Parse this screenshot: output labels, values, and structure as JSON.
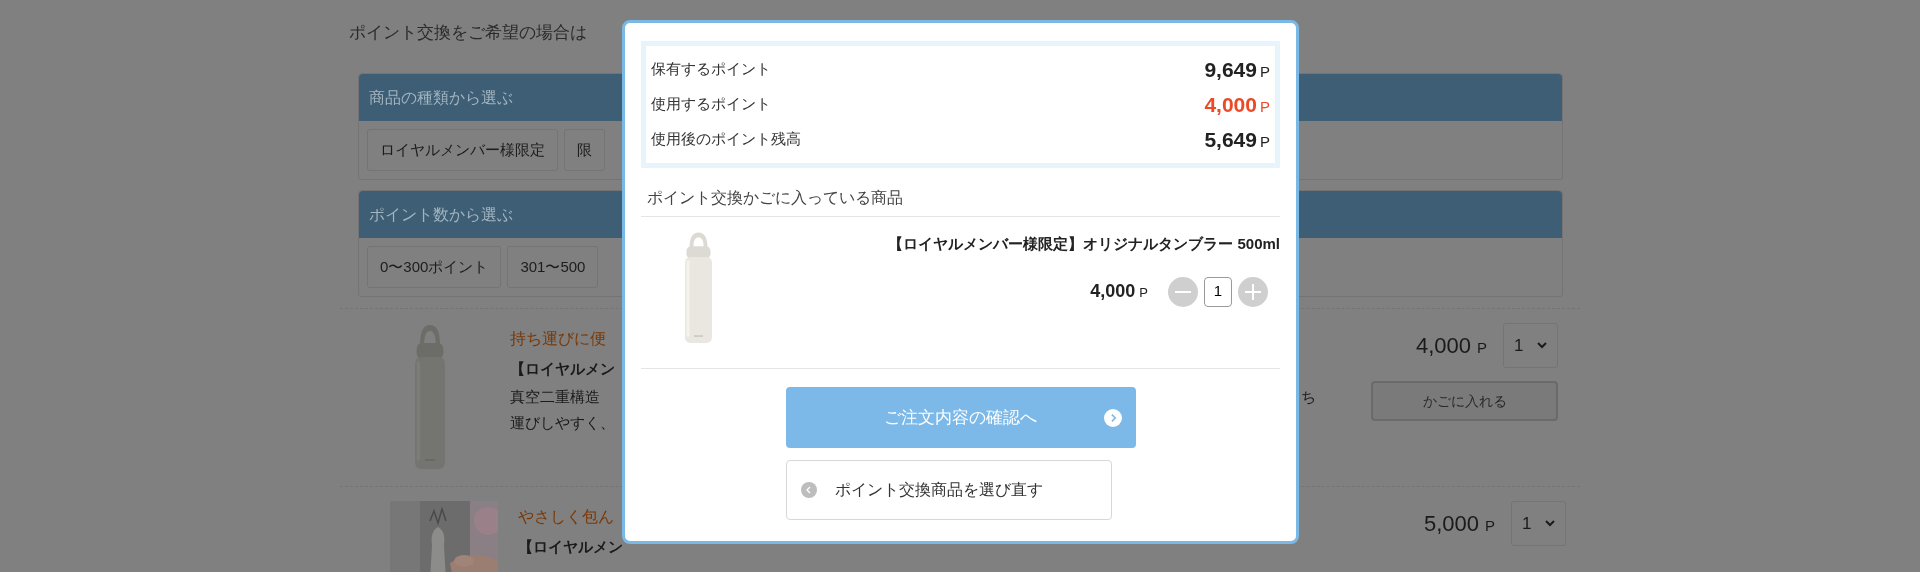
{
  "page": {
    "intro": "ポイント交換をご希望の場合は",
    "filters": [
      {
        "title": "商品の種類から選ぶ",
        "options": [
          "ロイヤルメンバー様限定",
          "限"
        ]
      },
      {
        "title": "ポイント数から選ぶ",
        "options": [
          "0〜300ポイント",
          "301〜500"
        ]
      }
    ],
    "products": [
      {
        "kind": "bottle",
        "catch": "持ち運びに便",
        "name": "【ロイヤルメン",
        "description": [
          "真空二重構造",
          "運びしやすく、"
        ],
        "description_end": "ち",
        "price": "4,000",
        "unit": "P",
        "quantity": "1",
        "button": "かごに入れる"
      },
      {
        "catch": "やさしく包ん",
        "name": "【ロイヤルメン",
        "price": "5,000",
        "unit": "P",
        "quantity": "1"
      }
    ]
  },
  "modal": {
    "points": [
      {
        "label": "保有するポイント",
        "value": "9,649",
        "unit": "P",
        "highlight": false
      },
      {
        "label": "使用するポイント",
        "value": "4,000",
        "unit": "P",
        "highlight": true
      },
      {
        "label": "使用後のポイント残高",
        "value": "5,649",
        "unit": "P",
        "highlight": false
      }
    ],
    "cart_title": "ポイント交換かごに入っている商品",
    "items": [
      {
        "name": "【ロイヤルメンバー様限定】オリジナルタンブラー 500ml",
        "price": "4,000",
        "unit": "P",
        "quantity": "1"
      }
    ],
    "confirm_button": "ご注文内容の確認へ",
    "back_button": "ポイント交換商品を選び直す"
  }
}
